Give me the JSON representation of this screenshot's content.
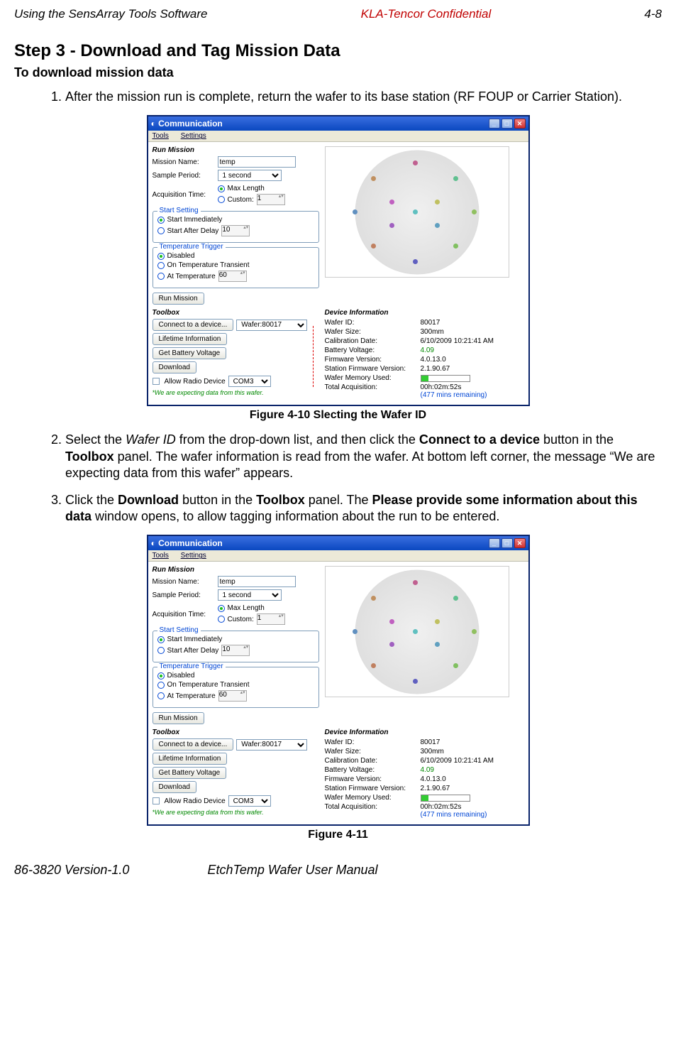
{
  "header": {
    "left": "Using the SensArray Tools Software",
    "center": "KLA-Tencor Confidential",
    "right": "4-8"
  },
  "step_title": "Step 3 - Download and Tag Mission Data",
  "sub_title": "To download mission data",
  "list_item_1": "After the mission run is complete, return the wafer to its base station (RF FOUP or Carrier Station).",
  "list_item_2_a": "Select the ",
  "list_item_2_b": "Wafer ID",
  "list_item_2_c": " from the drop-down list, and then click the ",
  "list_item_2_d": "Connect to a device",
  "list_item_2_e": " button in the ",
  "list_item_2_f": "Toolbox",
  "list_item_2_g": " panel. The wafer information is read from the wafer. At bottom left corner, the message “We are expecting data from this wafer” appears.",
  "list_item_3_a": "Click the ",
  "list_item_3_b": "Download",
  "list_item_3_c": " button in the ",
  "list_item_3_d": "Toolbox",
  "list_item_3_e": " panel. The ",
  "list_item_3_f": "Please provide some information about this data",
  "list_item_3_g": " window opens, to allow tagging information about the run to be entered.",
  "caption_1": "Figure 4-10 Slecting the Wafer ID",
  "caption_2": "Figure 4-11",
  "footer": {
    "left": "86-3820 Version-1.0",
    "right": "EtchTemp Wafer User Manual"
  },
  "win": {
    "title": "Communication",
    "menu": {
      "tools": "Tools",
      "settings": "Settings"
    },
    "run_mission_hdr": "Run Mission",
    "mission_name_lbl": "Mission Name:",
    "mission_name_val": "temp",
    "sample_period_lbl": "Sample Period:",
    "sample_period_val": "1 second",
    "acq_time_lbl": "Acquisition Time:",
    "acq_max": "Max Length",
    "acq_custom": "Custom:",
    "acq_custom_val": "1",
    "start_setting_legend": "Start Setting",
    "start_immediately": "Start Immediately",
    "start_after_delay": "Start After Delay",
    "start_delay_val": "10",
    "temp_trigger_legend": "Temperature Trigger",
    "temp_disabled": "Disabled",
    "temp_transient": "On Temperature Transient",
    "temp_at": "At Temperature",
    "temp_at_val": "60",
    "run_mission_btn": "Run Mission",
    "toolbox_hdr": "Toolbox",
    "connect_btn": "Connect to a device...",
    "wafer_sel": "Wafer:80017",
    "lifetime_btn": "Lifetime Information",
    "battery_btn": "Get Battery Voltage",
    "download_btn": "Download",
    "allow_radio": "Allow Radio Device",
    "com_sel": "COM3",
    "expecting_msg": "*We are expecting data from this wafer.",
    "devinfo_hdr": "Device Information",
    "dev": {
      "wafer_id_k": "Wafer ID:",
      "wafer_id_v": "80017",
      "wafer_size_k": "Wafer Size:",
      "wafer_size_v": "300mm",
      "calib_date_k": "Calibration Date:",
      "calib_date_v": "6/10/2009 10:21:41 AM",
      "battery_k": "Battery Voltage:",
      "battery_v": "4.09",
      "fw_k": "Firmware Version:",
      "fw_v": "4.0.13.0",
      "sfw_k": "Station Firmware Version:",
      "sfw_v": "2.1.90.67",
      "mem_k": "Wafer Memory Used:",
      "acq_k": "Total Acquisition:",
      "acq_v": "00h:02m:52s",
      "acq_rem": "(477 mins remaining)"
    }
  }
}
